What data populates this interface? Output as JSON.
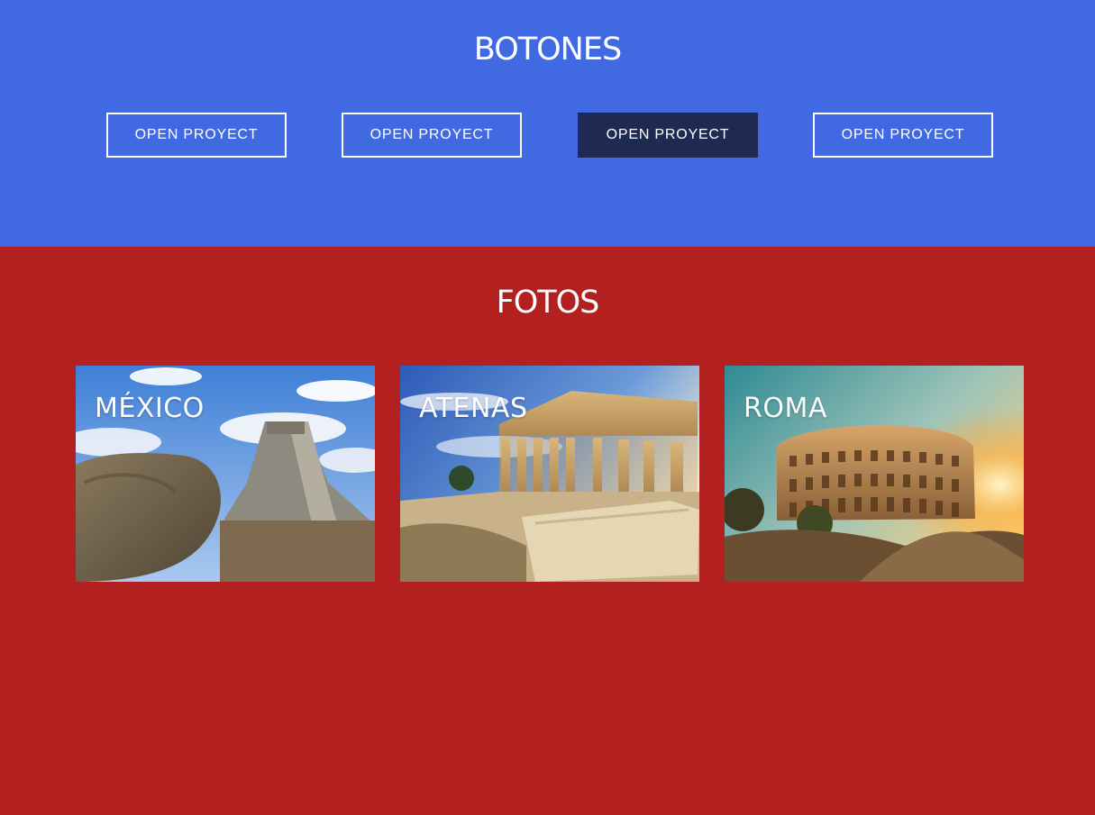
{
  "colors": {
    "buttons_section_bg": "#4169e1",
    "photos_section_bg": "#b22020",
    "active_button_bg": "#1e2a52",
    "text": "#ffffff"
  },
  "buttons_section": {
    "title": "BOTONES",
    "buttons": [
      {
        "label": "OPEN PROYECT",
        "state": "default"
      },
      {
        "label": "OPEN PROYECT",
        "state": "default"
      },
      {
        "label": "OPEN PROYECT",
        "state": "active"
      },
      {
        "label": "OPEN PROYECT",
        "state": "default"
      }
    ]
  },
  "photos_section": {
    "title": "FOTOS",
    "cards": [
      {
        "label": "MÉXICO",
        "image": "chichen-itza-pyramid-photo"
      },
      {
        "label": "ATENAS",
        "image": "parthenon-acropolis-photo"
      },
      {
        "label": "ROMA",
        "image": "colosseum-sunset-photo"
      }
    ]
  }
}
